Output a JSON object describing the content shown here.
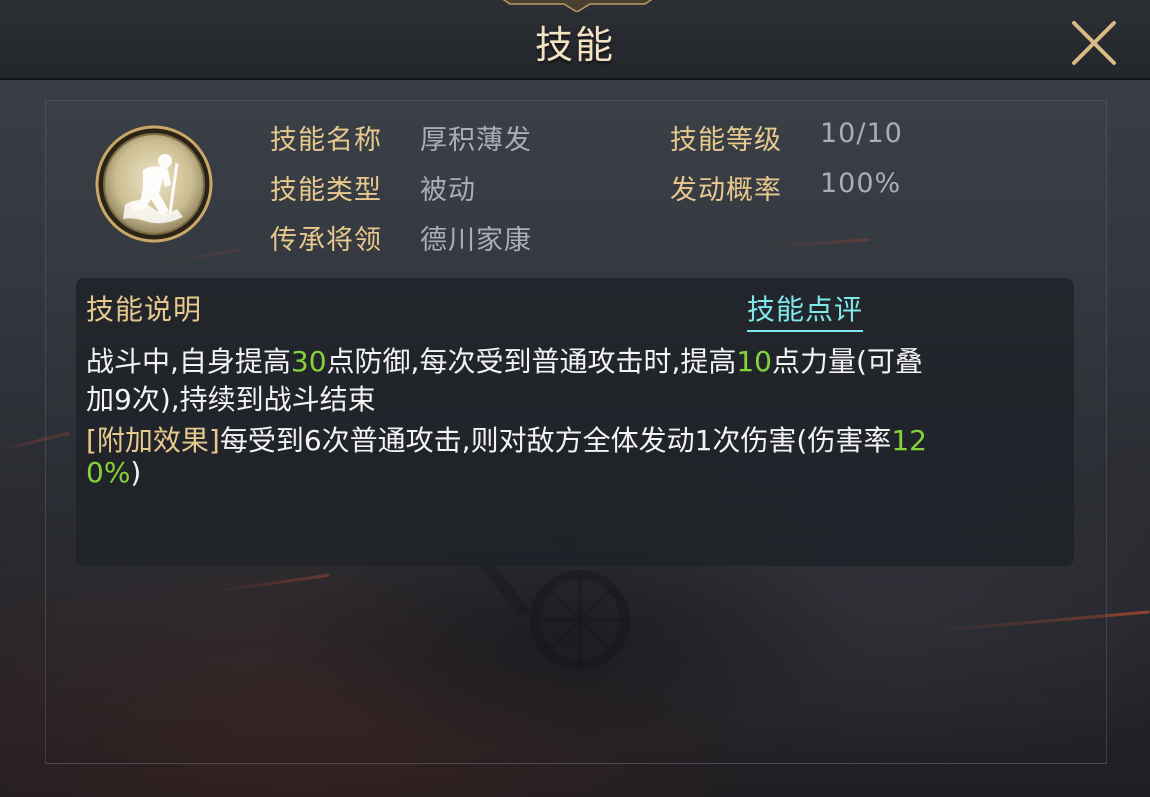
{
  "header": {
    "title": "技能"
  },
  "skill": {
    "icon": "kneeling-warrior-icon",
    "labels": {
      "name": "技能名称",
      "type": "技能类型",
      "inherit": "传承将领",
      "level": "技能等级",
      "rate": "发动概率"
    },
    "values": {
      "name": "厚积薄发",
      "type": "被动",
      "inherit": "德川家康",
      "level": "10/10",
      "rate": "100%"
    }
  },
  "description": {
    "title": "技能说明",
    "review_link": "技能点评",
    "line1": {
      "p1": "战斗中,自身提高",
      "n1": "30",
      "p2": "点防御,每次受到普通攻击时,提高",
      "n2": "10",
      "p3": "点力量(可叠"
    },
    "line2": "加9次),持续到战斗结束",
    "line3": {
      "tag": "[附加效果]",
      "text": "每受到6次普通攻击,则对敌方全体发动1次伤害(伤害率",
      "n": "12"
    },
    "line4": {
      "n": "0%",
      "text": ")"
    }
  },
  "colors": {
    "label_gold": "#e7c98e",
    "value_gray": "#a9adb4",
    "highlight_green": "#86d23a",
    "link_cyan": "#7fe8ea"
  }
}
